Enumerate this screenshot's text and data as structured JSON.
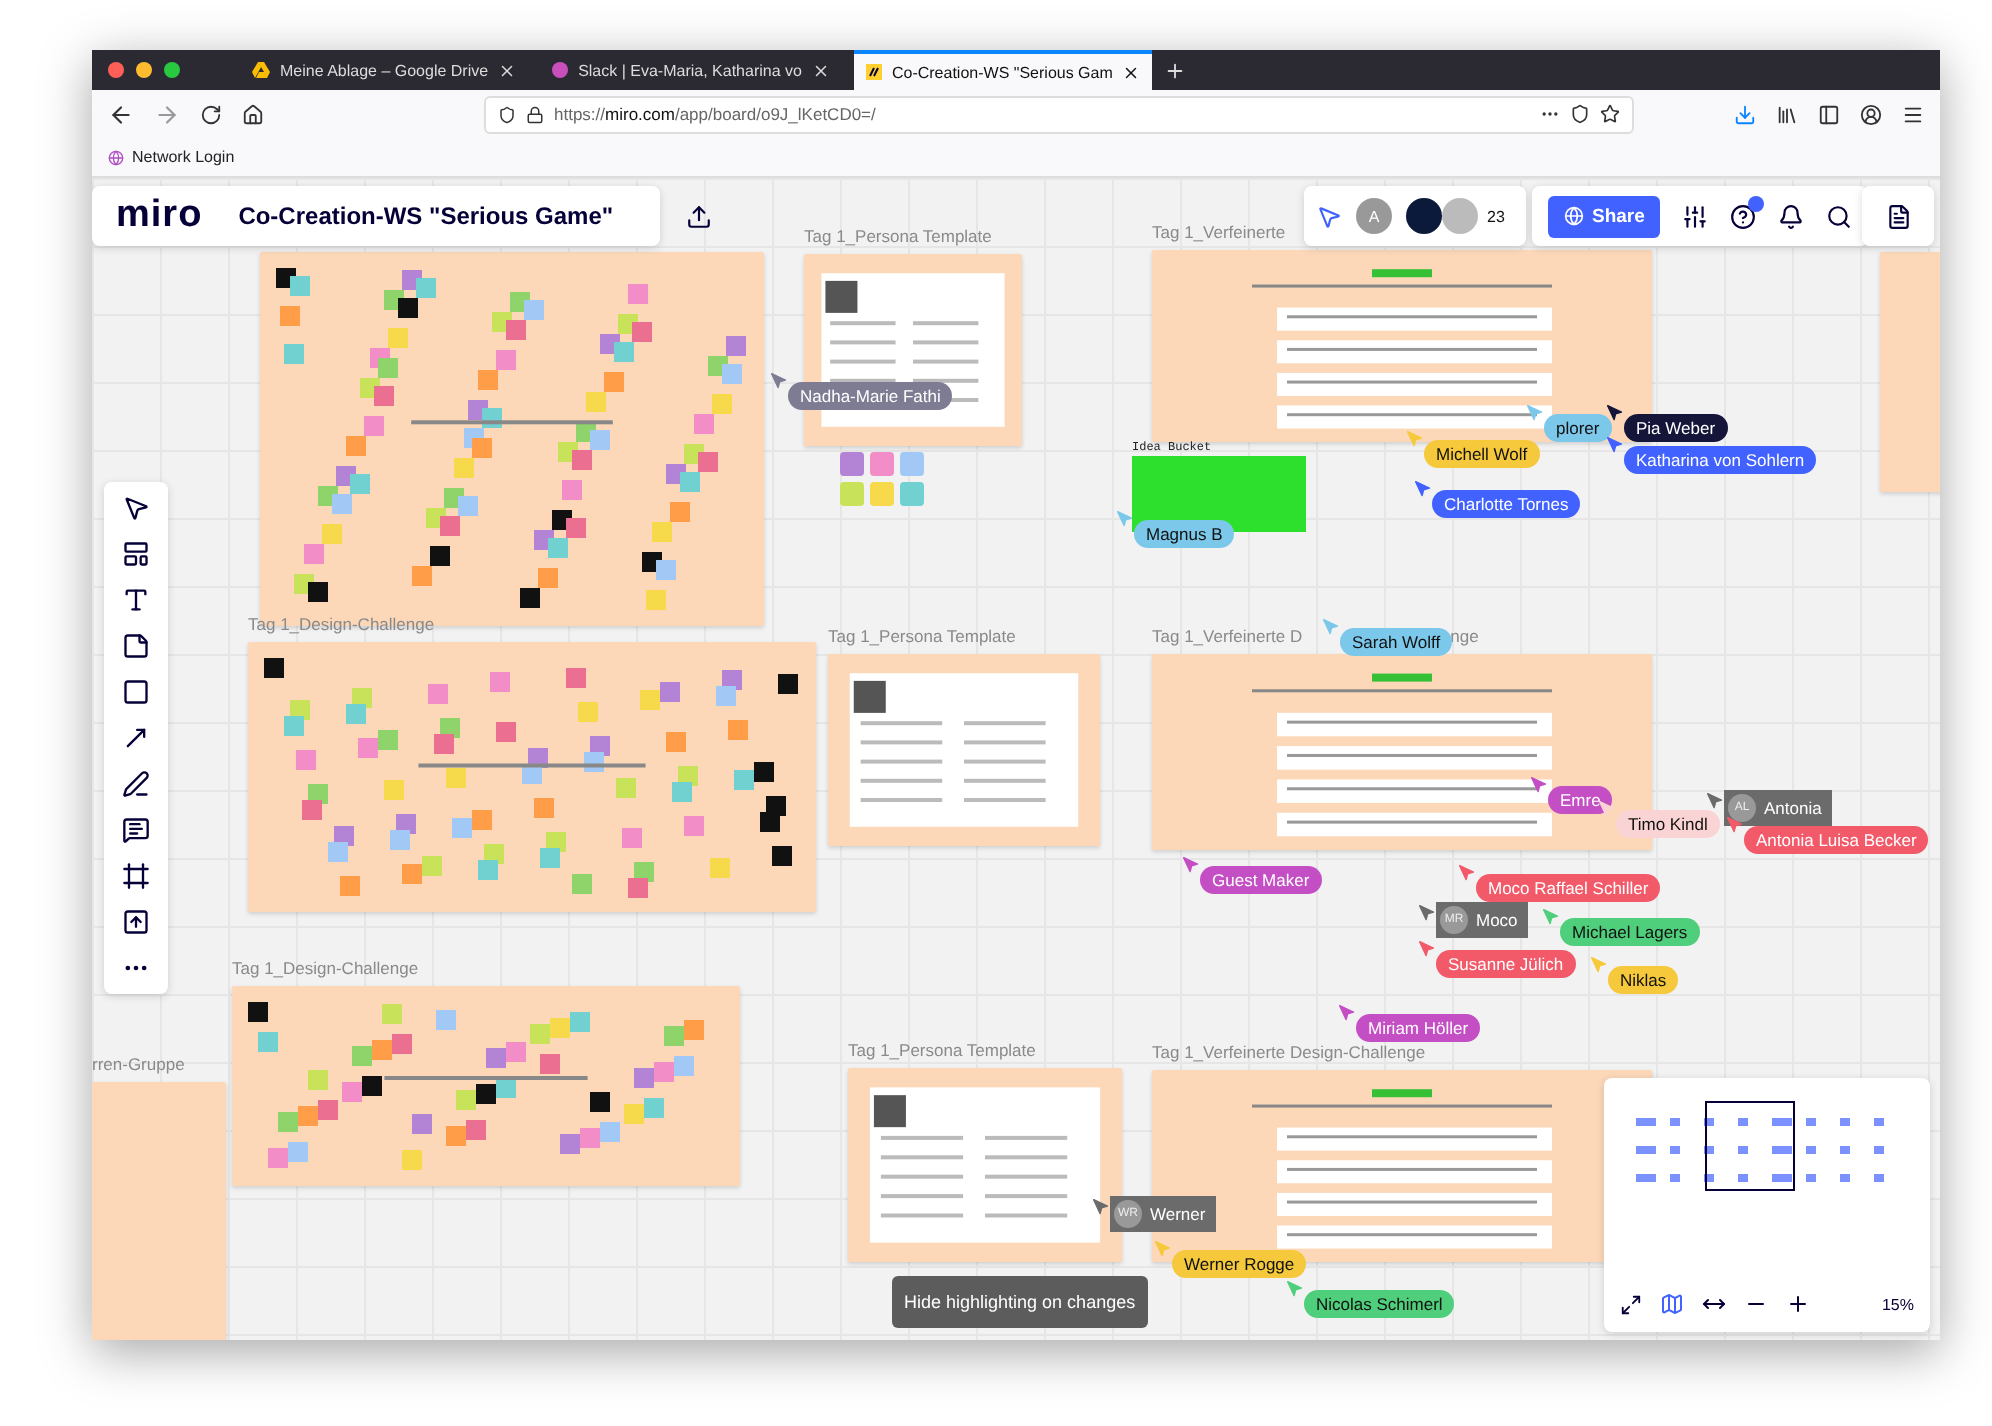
{
  "browser": {
    "tabs": [
      {
        "title": "Meine Ablage – Google Drive",
        "selected": false
      },
      {
        "title": "Slack | Eva-Maria, Katharina vo",
        "selected": false
      },
      {
        "title": "Co-Creation-WS \"Serious Gam",
        "selected": true
      }
    ],
    "url_prefix": "https://",
    "url_host": "miro.com",
    "url_path": "/app/board/o9J_lKetCD0=/",
    "bookmarks": [
      "Network Login"
    ]
  },
  "board": {
    "logo": "miro",
    "title": "Co-Creation-WS \"Serious Game\"",
    "collaborator_initial": "A",
    "collaborator_count": "23",
    "share": "Share"
  },
  "frames": [
    {
      "kind": "design"
    },
    {
      "kind": "persona",
      "title": "Tag 1_Persona Template"
    },
    {
      "kind": "refined",
      "title": "Tag 1_Verfeinerte"
    },
    {
      "kind": "blank"
    },
    {
      "kind": "design",
      "title": "Tag 1_Design-Challenge"
    },
    {
      "kind": "persona",
      "title": "Tag 1_Persona Template"
    },
    {
      "kind": "refined",
      "title": "Tag 1_Verfeinerte D",
      "title_tail": "nge"
    },
    {
      "kind": "design",
      "title": "Tag 1_Design-Challenge"
    },
    {
      "kind": "persona",
      "title": "Tag 1_Persona Template"
    },
    {
      "kind": "refined",
      "title": "Tag 1_Verfeinerte Design-Challenge"
    },
    {
      "kind": "blank",
      "title": "rren-Gruppe"
    }
  ],
  "idea_bucket": {
    "label": "Idea Bucket"
  },
  "cursors": [
    {
      "kind": "tag",
      "name": "Nadha-Marie Fathi",
      "color": "#7d7c93"
    },
    {
      "kind": "tag",
      "name": "plorer",
      "color": "#7cc8ea"
    },
    {
      "kind": "tag",
      "name": "Michell Wolf",
      "color": "#f5c93b"
    },
    {
      "kind": "tag",
      "name": "Pia Weber",
      "color": "#15153a"
    },
    {
      "kind": "tag",
      "name": "Katharina von Sohlern",
      "color": "#4262ff"
    },
    {
      "kind": "tag",
      "name": "Charlotte Tornes",
      "color": "#4262ff"
    },
    {
      "kind": "tag",
      "name": "Magnus B",
      "color": "#7cc8ea"
    },
    {
      "kind": "tag",
      "name": "Sarah Wolff",
      "color": "#7cc8ea"
    },
    {
      "kind": "tag",
      "name": "Emre",
      "color": "#c44ec4"
    },
    {
      "kind": "avatar",
      "initials": "AL",
      "name": "Antonia",
      "color": "#6b6b6b"
    },
    {
      "kind": "tag",
      "name": "Timo Kindl",
      "color": "#fad4d4"
    },
    {
      "kind": "tag",
      "name": "Antonia Luisa Becker",
      "color": "#f25a6a"
    },
    {
      "kind": "tag",
      "name": "Guest Maker",
      "color": "#c44ec4"
    },
    {
      "kind": "tag",
      "name": "Moco Raffael Schiller",
      "color": "#f25a6a"
    },
    {
      "kind": "avatar",
      "initials": "MR",
      "name": "Moco",
      "color": "#6b6b6b"
    },
    {
      "kind": "tag",
      "name": "Michael Lagers",
      "color": "#4fcf7b"
    },
    {
      "kind": "tag",
      "name": "Susanne Jülich",
      "color": "#f25a6a"
    },
    {
      "kind": "tag",
      "name": "Niklas",
      "color": "#f5c93b"
    },
    {
      "kind": "tag",
      "name": "Miriam Höller",
      "color": "#c44ec4"
    },
    {
      "kind": "avatar",
      "initials": "WR",
      "name": "Werner",
      "color": "#6b6b6b"
    },
    {
      "kind": "tag",
      "name": "Werner Rogge",
      "color": "#f5c93b"
    },
    {
      "kind": "tag",
      "name": "Nicolas Schimerl",
      "color": "#4fcf7b"
    }
  ],
  "notice": "Hide highlighting on changes",
  "minimap": {
    "zoom": "15%"
  }
}
